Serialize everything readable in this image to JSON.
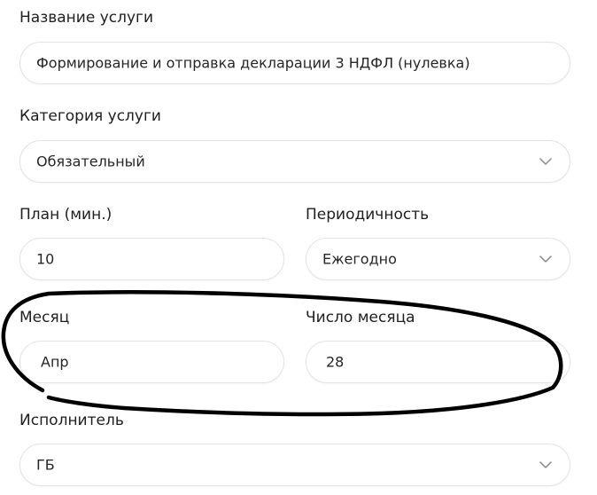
{
  "form": {
    "service_name": {
      "label": "Название услуги",
      "value": "Формирование и отправка декларации 3 НДФЛ (нулевка)"
    },
    "service_category": {
      "label": "Категория услуги",
      "value": "Обязательный"
    },
    "plan_minutes": {
      "label": "План (мин.)",
      "value": "10"
    },
    "periodicity": {
      "label": "Периодичность",
      "value": "Ежегодно"
    },
    "month": {
      "label": "Месяц",
      "value": "Апр"
    },
    "day_of_month": {
      "label": "Число месяца",
      "value": "28"
    },
    "executor": {
      "label": "Исполнитель",
      "value": "ГБ"
    }
  },
  "icons": {
    "dropdown": "chevron-down-icon"
  },
  "colors": {
    "border": "#e3e3e3",
    "text": "#1f1f1f",
    "chevron": "#8a8a8a",
    "annotation_stroke": "#000000"
  }
}
